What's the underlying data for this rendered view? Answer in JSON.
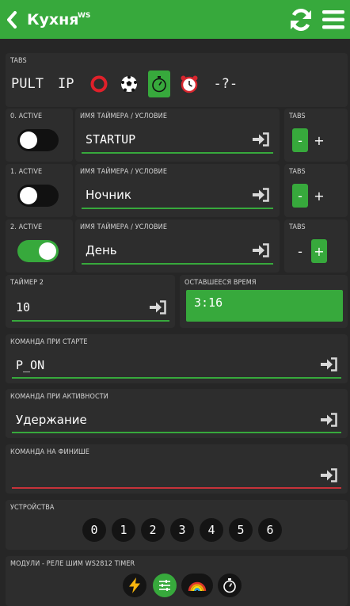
{
  "header": {
    "title": "Кухня",
    "title_sup": "WS",
    "bg_color": "#37a93c"
  },
  "tabs_card": {
    "label": "TABS",
    "items": [
      {
        "type": "text",
        "label": "PULT"
      },
      {
        "type": "text",
        "label": "IP"
      },
      {
        "type": "icon",
        "icon": "red-circle-icon"
      },
      {
        "type": "icon",
        "icon": "soccer-ball-icon"
      },
      {
        "type": "icon",
        "icon": "stopwatch-icon",
        "active": true
      },
      {
        "type": "icon",
        "icon": "alarm-clock-icon"
      },
      {
        "type": "text",
        "label": "-?-"
      }
    ]
  },
  "timers": [
    {
      "active_label": "0. ACTIVE",
      "active": false,
      "name_label": "ИМЯ ТАЙМЕРА / УСЛОВИЕ",
      "name_value": "STARTUP",
      "tabs_label": "TABS",
      "minus": "-",
      "plus": "+",
      "minus_active": true,
      "plus_active": false
    },
    {
      "active_label": "1. ACTIVE",
      "active": false,
      "name_label": "ИМЯ ТАЙМЕРА / УСЛОВИЕ",
      "name_value": "Ночник",
      "tabs_label": "TABS",
      "minus": "-",
      "plus": "+",
      "minus_active": true,
      "plus_active": false
    },
    {
      "active_label": "2. ACTIVE",
      "active": true,
      "name_label": "ИМЯ ТАЙМЕРА / УСЛОВИЕ",
      "name_value": "День",
      "tabs_label": "TABS",
      "minus": "-",
      "plus": "+",
      "minus_active": false,
      "plus_active": true
    }
  ],
  "timer2": {
    "label": "ТАЙМЕР 2",
    "value": "10"
  },
  "remaining": {
    "label": "ОСТАВШЕЕСЯ ВРЕМЯ",
    "value": "3:16"
  },
  "cmd_start": {
    "label": "КОМАНДА ПРИ СТАРТЕ",
    "value": "P_ON"
  },
  "cmd_active": {
    "label": "КОМАНДА ПРИ АКТИВНОСТИ",
    "value": "Удержание"
  },
  "cmd_finish": {
    "label": "КОМАНДА НА ФИНИШЕ",
    "value": ""
  },
  "devices": {
    "label": "УСТРОЙСТВА",
    "items": [
      "0",
      "1",
      "2",
      "3",
      "4",
      "5",
      "6"
    ]
  },
  "modules": {
    "label": "МОДУЛИ - РЕЛЕ ШИМ WS2812 TIMER",
    "items": [
      {
        "icon": "lightning-icon",
        "active": false
      },
      {
        "icon": "sliders-icon",
        "active": true
      },
      {
        "icon": "rainbow-icon",
        "active": false
      },
      {
        "icon": "stopwatch-icon",
        "active": false
      }
    ]
  },
  "colors": {
    "accent": "#37a93c",
    "error": "#c7323a",
    "card": "#2d2d2d",
    "background": "#262626"
  }
}
